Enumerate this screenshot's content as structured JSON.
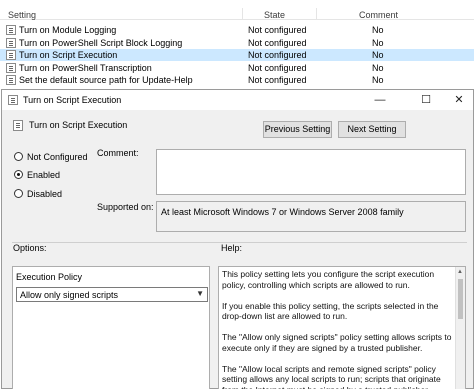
{
  "policy_list": {
    "columns": {
      "setting": "Setting",
      "state": "State",
      "comment": "Comment"
    },
    "rows": [
      {
        "name": "Turn on Module Logging",
        "state": "Not configured",
        "comment": "No"
      },
      {
        "name": "Turn on PowerShell Script Block Logging",
        "state": "Not configured",
        "comment": "No"
      },
      {
        "name": "Turn on Script Execution",
        "state": "Not configured",
        "comment": "No"
      },
      {
        "name": "Turn on PowerShell Transcription",
        "state": "Not configured",
        "comment": "No"
      },
      {
        "name": "Set the default source path for Update-Help",
        "state": "Not configured",
        "comment": "No"
      }
    ],
    "selected_row": 2
  },
  "dialog": {
    "title": "Turn on Script Execution",
    "heading": "Turn on Script Execution",
    "window_controls": {
      "minimize": "—",
      "maximize": "☐",
      "close": "✕"
    },
    "previous_button": "Previous Setting",
    "next_button": "Next Setting",
    "radio_options": {
      "not_configured": "Not Configured",
      "enabled": "Enabled",
      "disabled": "Disabled"
    },
    "selected_option": "enabled",
    "comment_label": "Comment:",
    "comment_value": "",
    "supported_label": "Supported on:",
    "supported_value": "At least Microsoft Windows 7 or Windows Server 2008 family",
    "options_label": "Options:",
    "help_label": "Help:",
    "options": {
      "title": "Execution Policy",
      "selected": "Allow only signed scripts"
    },
    "help_paragraphs": [
      "This policy setting lets you configure the script execution policy, controlling which scripts are allowed to run.",
      "If you enable this policy setting, the scripts selected in the drop-down list are allowed to run.",
      "The \"Allow only signed scripts\" policy setting allows scripts to execute only if they are signed by a trusted publisher.",
      "The \"Allow local scripts and remote signed scripts\" policy setting allows any local scripts to run; scripts that originate from the Internet must be signed by a trusted publisher."
    ]
  }
}
